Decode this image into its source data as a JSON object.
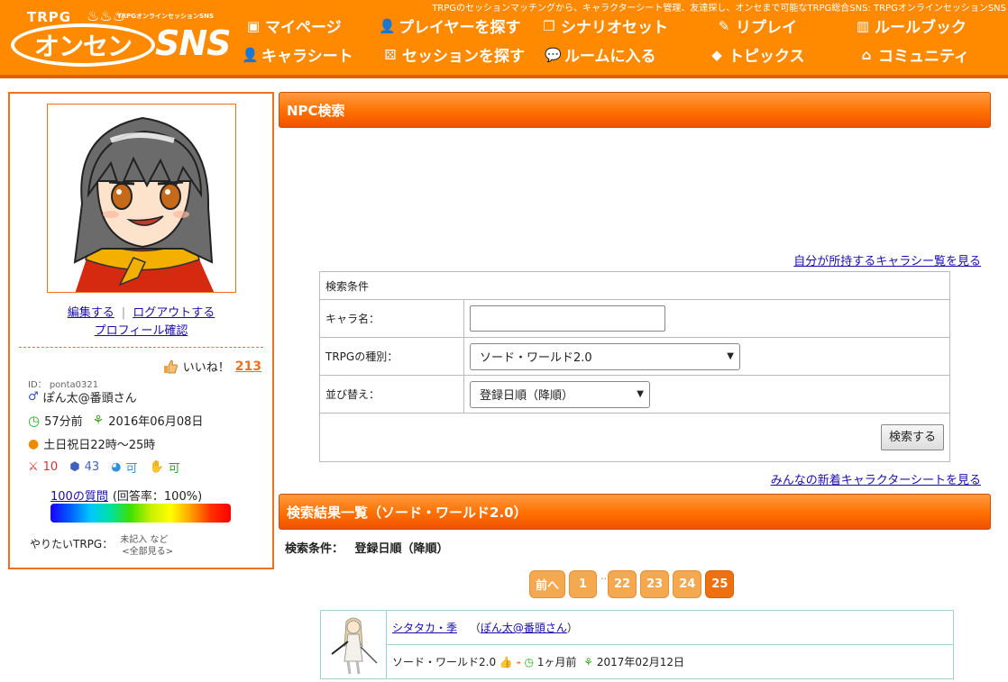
{
  "header": {
    "tagline": "TRPGのセッションマッチングから、キャラクターシート管理、友達探し、オンセまで可能なTRPG総合SNS: TRPGオンラインセッションSNS",
    "logo": {
      "top": "TRPG",
      "sub": "TRPGオンラインセッションSNS",
      "main": "オンセン",
      "sns": "SNS"
    },
    "nav": [
      {
        "label": "マイページ",
        "icon": "mypage-icon"
      },
      {
        "label": "プレイヤーを探す",
        "icon": "player-search-icon"
      },
      {
        "label": "シナリオセット",
        "icon": "scenario-icon"
      },
      {
        "label": "リプレイ",
        "icon": "replay-icon"
      },
      {
        "label": "ルールブック",
        "icon": "rulebook-icon"
      },
      {
        "label": "キャラシート",
        "icon": "charsheet-icon"
      },
      {
        "label": "セッションを探す",
        "icon": "dice-icon"
      },
      {
        "label": "ルームに入る",
        "icon": "chat-icon"
      },
      {
        "label": "トピックス",
        "icon": "tag-icon"
      },
      {
        "label": "コミュニティ",
        "icon": "community-icon"
      }
    ]
  },
  "sidebar": {
    "edit_link": "編集する",
    "separator": "|",
    "logout_link": "ログアウトする",
    "profile_link": "プロフィール確認",
    "like_label": "いいね！",
    "like_count": "213",
    "id_line": "ID： ponta0321",
    "gender_icon": "♂",
    "username": "ぽん太@番頭さん",
    "last_login": "57分前",
    "registered": "2016年06月08日",
    "play_time": "土日祝日22時～25時",
    "stat_sword": "10",
    "stat_dice": "43",
    "stat_voice": "可",
    "stat_hand": "可",
    "questions_link": "100の質問",
    "answer_rate": "(回答率：100%)",
    "want_label": "やりたいTRPG：",
    "want_value": "未記入 など",
    "want_all": "<全部見る>"
  },
  "main": {
    "title": "NPC検索",
    "own_sheets_link": "自分が所持するキャラシー覧を見る",
    "search": {
      "header": "検索条件",
      "name_label": "キャラ名：",
      "name_value": "",
      "system_label": "TRPGの種別：",
      "system_value": "ソード・ワールド2.0",
      "sort_label": "並び替え：",
      "sort_value": "登録日順（降順）",
      "submit": "検索する"
    },
    "new_sheets_link": "みんなの新着キャラクターシートを見る",
    "results_title": "検索結果一覧（ソード・ワールド2.0）",
    "condition_label": "検索条件：",
    "condition_value": "登録日順（降順）",
    "pager": {
      "prev": "前へ",
      "first": "1",
      "dots": "..",
      "pages": [
        "22",
        "23",
        "24",
        "25"
      ],
      "current": "25"
    },
    "results": [
      {
        "name": "シタタカ・季",
        "owner": "ぽん太@番頭さん",
        "system": "ソード・ワールド2.0",
        "dash": "-",
        "updated": "1ヶ月前",
        "created": "2017年02月12日"
      }
    ]
  }
}
